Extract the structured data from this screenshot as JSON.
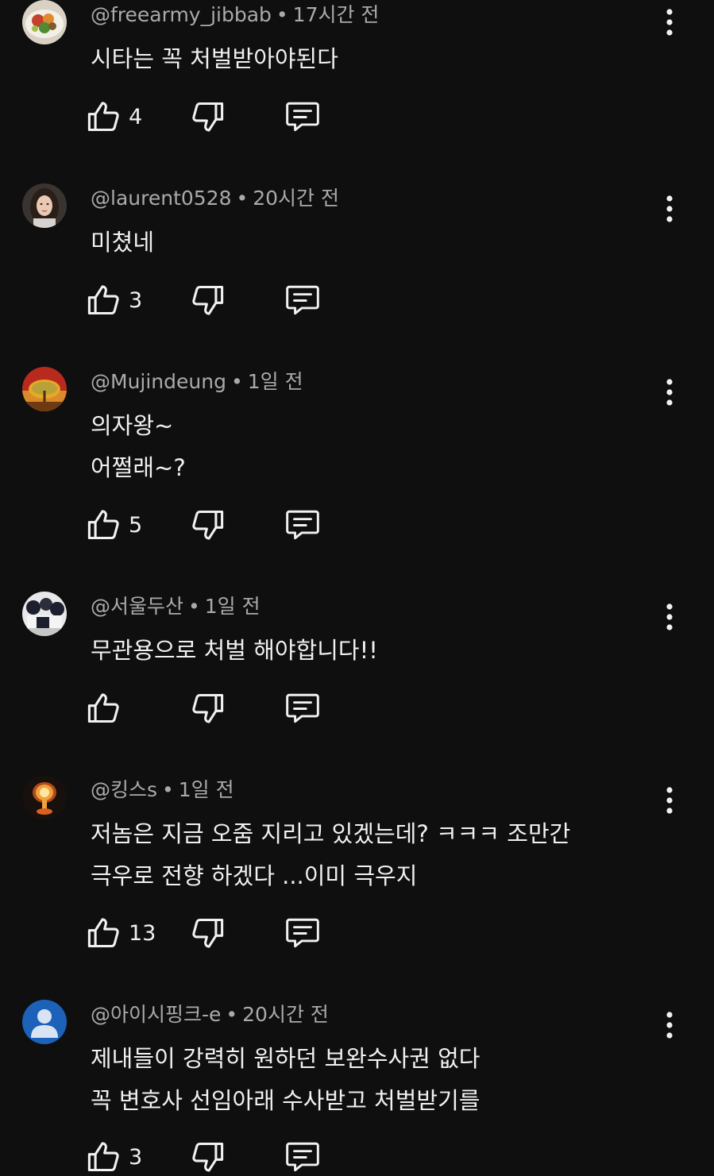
{
  "comments": [
    {
      "handle": "@freearmy_jibbab",
      "time": "17시간 전",
      "lines": [
        "시타는 꼭 처벌받아야된다"
      ],
      "likes": "4",
      "avatar": "food-photo-avatar"
    },
    {
      "handle": "@laurent0528",
      "time": "20시간 전",
      "lines": [
        "미쳤네"
      ],
      "likes": "3",
      "avatar": "portrait-photo-avatar"
    },
    {
      "handle": "@Mujindeung",
      "time": "1일 전",
      "lines": [
        "의자왕~",
        "어쩔래~?"
      ],
      "likes": "5",
      "avatar": "sunset-tree-avatar"
    },
    {
      "handle": "@서울두산",
      "time": "1일 전",
      "lines": [
        "무관용으로 처벌 해야합니다!!"
      ],
      "likes": "",
      "avatar": "sports-team-avatar"
    },
    {
      "handle": "@킹스s",
      "time": "1일 전",
      "lines": [
        "저놈은 지금 오줌 지리고 있겠는데? ㅋㅋㅋ 조만간",
        "극우로 전향 하겠다 ...이미 극우지"
      ],
      "likes": "13",
      "avatar": "explosion-avatar"
    },
    {
      "handle": "@아이시핑크-e",
      "time": "20시간 전",
      "lines": [
        "제내들이 강력히 원하던 보완수사권 없다",
        "꼭 변호사 선임아래 수사받고 처벌받기를"
      ],
      "likes": "3",
      "avatar": "default-user-avatar"
    }
  ],
  "separator": "•",
  "icons": {
    "like": "thumbs-up-icon",
    "dislike": "thumbs-down-icon",
    "reply": "comment-reply-icon",
    "more": "more-vertical-icon"
  },
  "colors": {
    "background": "#0f0f0f",
    "text": "#f1f1f1",
    "meta": "#aaaaaa",
    "default_avatar": "#1c62b9"
  }
}
